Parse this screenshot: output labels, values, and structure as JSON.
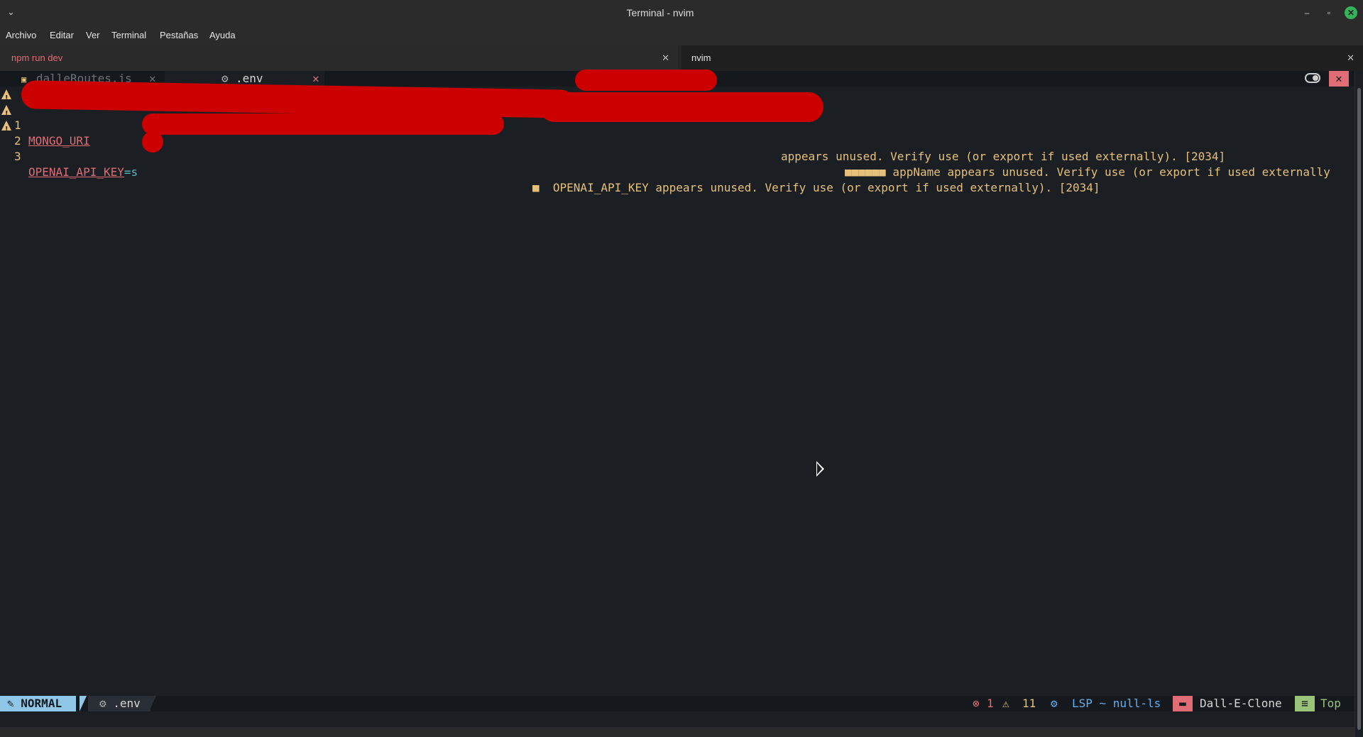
{
  "window": {
    "title": "Terminal - nvim",
    "chevron": "⌄",
    "minimize": "–",
    "maximize": "▫",
    "close": "✕"
  },
  "menu": [
    "Archivo",
    "Editar",
    "Ver",
    "Terminal",
    "Pestañas",
    "Ayuda"
  ],
  "terminal_tabs": [
    {
      "label": "npm run dev",
      "color": "#e06c75",
      "close": "✕"
    },
    {
      "label": "nvim",
      "color": "#e6e6e6",
      "close": "✕"
    }
  ],
  "buffer_tabs": [
    {
      "icon": "▣",
      "label": "dalleRoutes.js",
      "close": "✕"
    },
    {
      "icon": "⚙",
      "label": ".env",
      "close": "✕"
    }
  ],
  "lines": [
    {
      "num": "1",
      "code": "MONGO_URI",
      "diag": "appears unused. Verify use (or export if used externally). [2034]"
    },
    {
      "num": "2",
      "code": "",
      "diag": "■■■■■■ appName appears unused. Verify use (or export if used externally"
    },
    {
      "num": "3",
      "code": "OPENAI_API_KEY",
      "code_suffix": "=s",
      "diag": "■  OPENAI_API_KEY appears unused. Verify use (or export if used externally). [2034]"
    }
  ],
  "statusbar": {
    "mode": "NORMAL",
    "file_icon": "⚙",
    "file": ".env",
    "errors": "1",
    "warnings": "11",
    "lsp": "LSP ~ null-ls",
    "project": "Dall-E-Clone",
    "position": "Top"
  },
  "colors": {
    "warning": "#e6c07b",
    "error": "#e06c75",
    "mode_bg": "#8fc7e8"
  }
}
